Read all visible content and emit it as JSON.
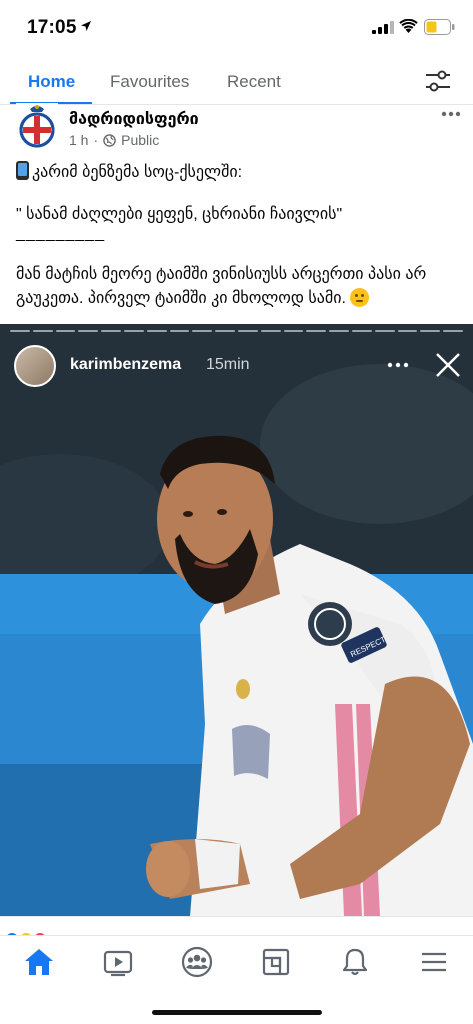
{
  "status_bar": {
    "time": "17:05",
    "icons": [
      "location-arrow-icon",
      "signal-icon",
      "wifi-icon",
      "battery-icon"
    ],
    "battery_color": "#f5c518"
  },
  "tabs": [
    {
      "label": "Home",
      "active": true
    },
    {
      "label": "Favourites",
      "active": false
    },
    {
      "label": "Recent",
      "active": false
    }
  ],
  "post": {
    "author": "მადრიდისფერი",
    "time": "1 h",
    "separator": "·",
    "privacy": "Public",
    "line1": "კარიმ ბენზემა სოც-ქსელში:",
    "line2": "\" სანამ ძაღლები ყეფენ, ცხრიანი ჩაივლის\"",
    "line3": "_________",
    "line4": "მან მატჩის მეორე ტაიმში ვინისიუსს არცერთი პასი არ გაუკეთა. პირველ ტაიმში კი მხოლოდ სამი."
  },
  "story": {
    "username": "karimbenzema",
    "time": "15min",
    "patch_text": "RESPECT"
  },
  "bottom_nav": [
    {
      "name": "home",
      "icon": "home-icon",
      "active": true
    },
    {
      "name": "watch",
      "icon": "video-icon",
      "active": false
    },
    {
      "name": "groups",
      "icon": "groups-icon",
      "active": false
    },
    {
      "name": "pages",
      "icon": "pages-icon",
      "active": false
    },
    {
      "name": "notifications",
      "icon": "bell-icon",
      "active": false
    },
    {
      "name": "menu",
      "icon": "menu-icon",
      "active": false
    }
  ],
  "colors": {
    "accent": "#1877f2",
    "text": "#050505",
    "muted": "#65676b",
    "jersey": "#f4f4f4"
  }
}
